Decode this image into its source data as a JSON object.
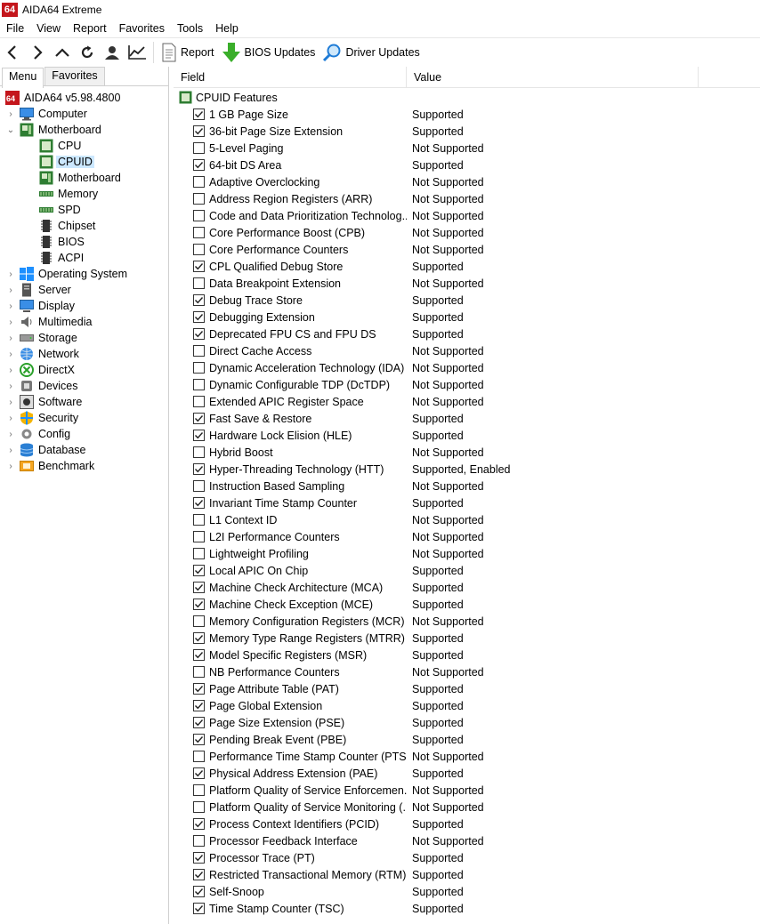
{
  "window": {
    "logo": "64",
    "title": "AIDA64 Extreme"
  },
  "menubar": [
    "File",
    "View",
    "Report",
    "Favorites",
    "Tools",
    "Help"
  ],
  "toolbar": {
    "nav_icons": [
      "back-icon",
      "forward-icon",
      "up-icon",
      "refresh-icon",
      "user-icon",
      "chart-icon"
    ],
    "report_label": "Report",
    "bios_label": "BIOS Updates",
    "driver_label": "Driver Updates"
  },
  "tabs": {
    "menu": "Menu",
    "favorites": "Favorites"
  },
  "tree": [
    {
      "label": "AIDA64 v5.98.4800",
      "level": 0,
      "chevron": "",
      "icon": "aida-icon"
    },
    {
      "label": "Computer",
      "level": 1,
      "chevron": "›",
      "icon": "computer-icon"
    },
    {
      "label": "Motherboard",
      "level": 1,
      "chevron": "⌄",
      "icon": "motherboard-icon"
    },
    {
      "label": "CPU",
      "level": 2,
      "chevron": "",
      "icon": "cpu-icon"
    },
    {
      "label": "CPUID",
      "level": 2,
      "chevron": "",
      "icon": "cpuid-icon",
      "selected": true
    },
    {
      "label": "Motherboard",
      "level": 2,
      "chevron": "",
      "icon": "motherboard-icon"
    },
    {
      "label": "Memory",
      "level": 2,
      "chevron": "",
      "icon": "memory-icon"
    },
    {
      "label": "SPD",
      "level": 2,
      "chevron": "",
      "icon": "spd-icon"
    },
    {
      "label": "Chipset",
      "level": 2,
      "chevron": "",
      "icon": "chipset-icon"
    },
    {
      "label": "BIOS",
      "level": 2,
      "chevron": "",
      "icon": "bios-icon"
    },
    {
      "label": "ACPI",
      "level": 2,
      "chevron": "",
      "icon": "acpi-icon"
    },
    {
      "label": "Operating System",
      "level": 1,
      "chevron": "›",
      "icon": "windows-icon"
    },
    {
      "label": "Server",
      "level": 1,
      "chevron": "›",
      "icon": "server-icon"
    },
    {
      "label": "Display",
      "level": 1,
      "chevron": "›",
      "icon": "display-icon"
    },
    {
      "label": "Multimedia",
      "level": 1,
      "chevron": "›",
      "icon": "multimedia-icon"
    },
    {
      "label": "Storage",
      "level": 1,
      "chevron": "›",
      "icon": "storage-icon"
    },
    {
      "label": "Network",
      "level": 1,
      "chevron": "›",
      "icon": "network-icon"
    },
    {
      "label": "DirectX",
      "level": 1,
      "chevron": "›",
      "icon": "directx-icon"
    },
    {
      "label": "Devices",
      "level": 1,
      "chevron": "›",
      "icon": "devices-icon"
    },
    {
      "label": "Software",
      "level": 1,
      "chevron": "›",
      "icon": "software-icon"
    },
    {
      "label": "Security",
      "level": 1,
      "chevron": "›",
      "icon": "security-icon"
    },
    {
      "label": "Config",
      "level": 1,
      "chevron": "›",
      "icon": "config-icon"
    },
    {
      "label": "Database",
      "level": 1,
      "chevron": "›",
      "icon": "database-icon"
    },
    {
      "label": "Benchmark",
      "level": 1,
      "chevron": "›",
      "icon": "benchmark-icon"
    }
  ],
  "columns": {
    "field": "Field",
    "value": "Value"
  },
  "group": "CPUID Features",
  "features": [
    {
      "field": "1 GB Page Size",
      "value": "Supported",
      "checked": true
    },
    {
      "field": "36-bit Page Size Extension",
      "value": "Supported",
      "checked": true
    },
    {
      "field": "5-Level Paging",
      "value": "Not Supported",
      "checked": false
    },
    {
      "field": "64-bit DS Area",
      "value": "Supported",
      "checked": true
    },
    {
      "field": "Adaptive Overclocking",
      "value": "Not Supported",
      "checked": false
    },
    {
      "field": "Address Region Registers (ARR)",
      "value": "Not Supported",
      "checked": false
    },
    {
      "field": "Code and Data Prioritization Technolog...",
      "value": "Not Supported",
      "checked": false
    },
    {
      "field": "Core Performance Boost (CPB)",
      "value": "Not Supported",
      "checked": false
    },
    {
      "field": "Core Performance Counters",
      "value": "Not Supported",
      "checked": false
    },
    {
      "field": "CPL Qualified Debug Store",
      "value": "Supported",
      "checked": true
    },
    {
      "field": "Data Breakpoint Extension",
      "value": "Not Supported",
      "checked": false
    },
    {
      "field": "Debug Trace Store",
      "value": "Supported",
      "checked": true
    },
    {
      "field": "Debugging Extension",
      "value": "Supported",
      "checked": true
    },
    {
      "field": "Deprecated FPU CS and FPU DS",
      "value": "Supported",
      "checked": true
    },
    {
      "field": "Direct Cache Access",
      "value": "Not Supported",
      "checked": false
    },
    {
      "field": "Dynamic Acceleration Technology (IDA)",
      "value": "Not Supported",
      "checked": false
    },
    {
      "field": "Dynamic Configurable TDP (DcTDP)",
      "value": "Not Supported",
      "checked": false
    },
    {
      "field": "Extended APIC Register Space",
      "value": "Not Supported",
      "checked": false
    },
    {
      "field": "Fast Save & Restore",
      "value": "Supported",
      "checked": true
    },
    {
      "field": "Hardware Lock Elision (HLE)",
      "value": "Supported",
      "checked": true
    },
    {
      "field": "Hybrid Boost",
      "value": "Not Supported",
      "checked": false
    },
    {
      "field": "Hyper-Threading Technology (HTT)",
      "value": "Supported, Enabled",
      "checked": true
    },
    {
      "field": "Instruction Based Sampling",
      "value": "Not Supported",
      "checked": false
    },
    {
      "field": "Invariant Time Stamp Counter",
      "value": "Supported",
      "checked": true
    },
    {
      "field": "L1 Context ID",
      "value": "Not Supported",
      "checked": false
    },
    {
      "field": "L2I Performance Counters",
      "value": "Not Supported",
      "checked": false
    },
    {
      "field": "Lightweight Profiling",
      "value": "Not Supported",
      "checked": false
    },
    {
      "field": "Local APIC On Chip",
      "value": "Supported",
      "checked": true
    },
    {
      "field": "Machine Check Architecture (MCA)",
      "value": "Supported",
      "checked": true
    },
    {
      "field": "Machine Check Exception (MCE)",
      "value": "Supported",
      "checked": true
    },
    {
      "field": "Memory Configuration Registers (MCR)",
      "value": "Not Supported",
      "checked": false
    },
    {
      "field": "Memory Type Range Registers (MTRR)",
      "value": "Supported",
      "checked": true
    },
    {
      "field": "Model Specific Registers (MSR)",
      "value": "Supported",
      "checked": true
    },
    {
      "field": "NB Performance Counters",
      "value": "Not Supported",
      "checked": false
    },
    {
      "field": "Page Attribute Table (PAT)",
      "value": "Supported",
      "checked": true
    },
    {
      "field": "Page Global Extension",
      "value": "Supported",
      "checked": true
    },
    {
      "field": "Page Size Extension (PSE)",
      "value": "Supported",
      "checked": true
    },
    {
      "field": "Pending Break Event (PBE)",
      "value": "Supported",
      "checked": true
    },
    {
      "field": "Performance Time Stamp Counter (PTSC)",
      "value": "Not Supported",
      "checked": false
    },
    {
      "field": "Physical Address Extension (PAE)",
      "value": "Supported",
      "checked": true
    },
    {
      "field": "Platform Quality of Service Enforcemen...",
      "value": "Not Supported",
      "checked": false
    },
    {
      "field": "Platform Quality of Service Monitoring (...",
      "value": "Not Supported",
      "checked": false
    },
    {
      "field": "Process Context Identifiers (PCID)",
      "value": "Supported",
      "checked": true
    },
    {
      "field": "Processor Feedback Interface",
      "value": "Not Supported",
      "checked": false
    },
    {
      "field": "Processor Trace (PT)",
      "value": "Supported",
      "checked": true
    },
    {
      "field": "Restricted Transactional Memory (RTM)",
      "value": "Supported",
      "checked": true
    },
    {
      "field": "Self-Snoop",
      "value": "Supported",
      "checked": true
    },
    {
      "field": "Time Stamp Counter (TSC)",
      "value": "Supported",
      "checked": true
    }
  ],
  "colors": {
    "selection": "#cce8ff",
    "logo_red": "#c4161c",
    "bios_green": "#3aae2a",
    "driver_blue": "#1e7bd6"
  }
}
